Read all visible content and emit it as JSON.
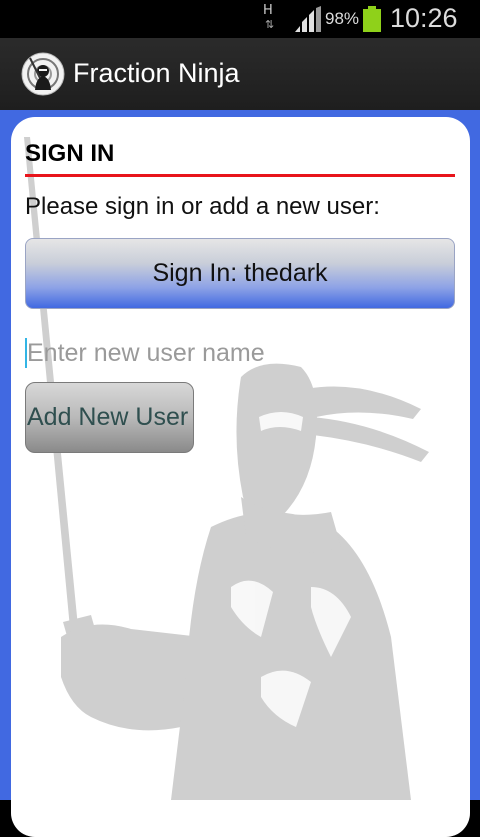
{
  "status_bar": {
    "network_type": "H",
    "battery_percent": "98%",
    "time": "10:26"
  },
  "action_bar": {
    "app_icon": "ninja-logo-icon",
    "title": "Fraction Ninja"
  },
  "signin": {
    "header": "SIGN IN",
    "prompt": "Please sign in or add a new user:",
    "signin_button_label": "Sign In: thedark",
    "new_user_placeholder": "Enter new user name",
    "new_user_value": "",
    "add_user_button_label": "Add New User"
  },
  "colors": {
    "accent_blue": "#4169e1",
    "header_rule_red": "#e8141b",
    "action_bar": "#262626",
    "battery_green": "#8fd11a"
  }
}
